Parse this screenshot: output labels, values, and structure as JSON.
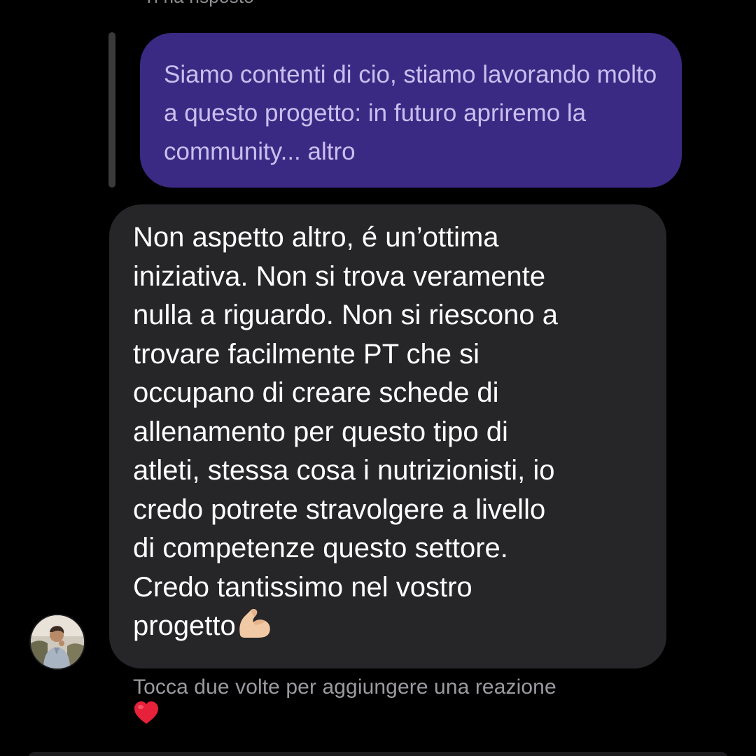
{
  "chat": {
    "reply_header": "Ti ha risposto",
    "quoted_message": "Siamo contenti di cio, stiamo lavorando molto a questo progetto: in futuro apriremo la community... altro",
    "message_text": "Non aspetto altro, é un’ottima\niniziativa. Non si trova veramente\nnulla a riguardo. Non si riescono a\ntrovare facilmente PT che si\noccupano di creare schede di\nallenamento per questo tipo di\natleti, stessa cosa i nutrizionisti, io\ncredo potrete stravolgere a livello\ndi competenze questo settore.\nCredo tantissimo nel vostro\nprogetto",
    "message_emoji": "flexed-biceps-icon",
    "hint": "Tocca due volte per aggiungere una reazione",
    "reaction_icon": "heart-icon"
  },
  "colors": {
    "background": "#000000",
    "quoted_bubble": "#3b2a84",
    "quoted_text": "#c9bfee",
    "message_bubble": "#262628",
    "message_text": "#ffffff",
    "hint_text": "#9a9aa0",
    "reaction": "#e8213a"
  }
}
